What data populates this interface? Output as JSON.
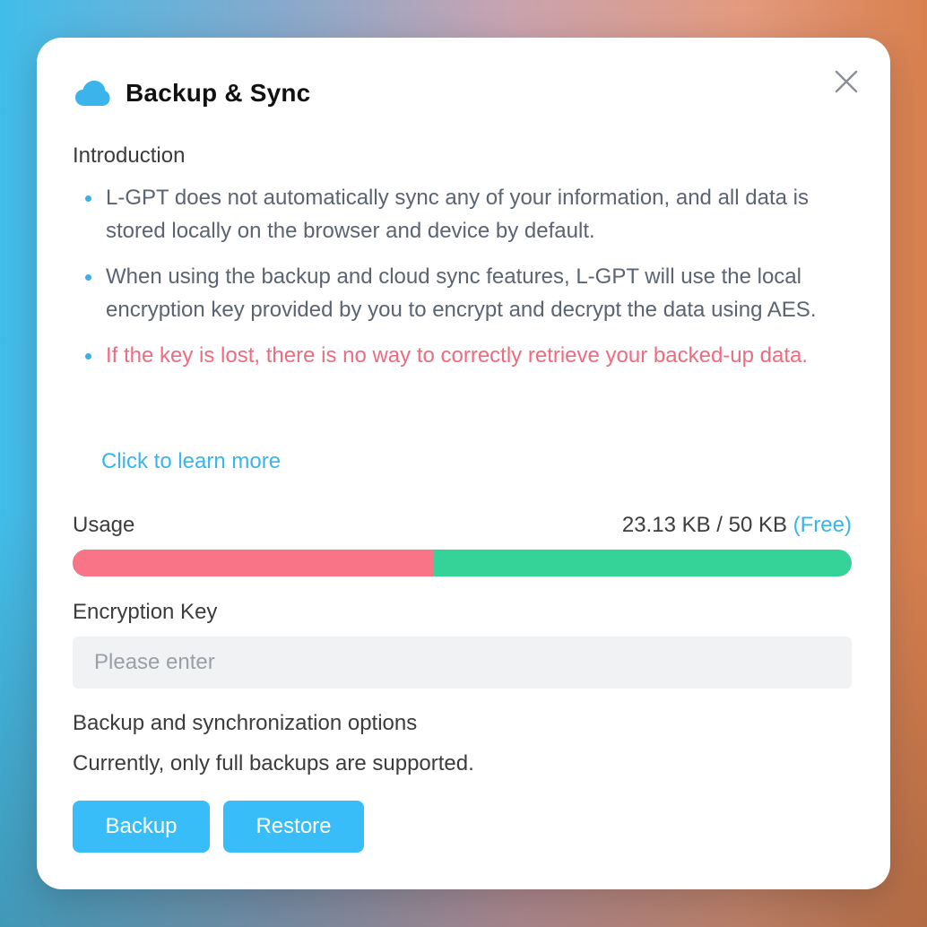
{
  "dialog": {
    "title": "Backup & Sync",
    "close_icon": "close-icon",
    "cloud_icon": "cloud-icon",
    "accent_color": "#38bdf8"
  },
  "intro": {
    "label": "Introduction",
    "bullets": [
      "L-GPT does not automatically sync any of your information, and all data is stored locally on the browser and device by default.",
      "When using the backup and cloud sync features, L-GPT will use the local encryption key provided by you to encrypt and decrypt the data using AES.",
      "If the key is lost, there is no way to correctly retrieve your backed-up data."
    ],
    "learn_more": "Click to learn more"
  },
  "usage": {
    "label": "Usage",
    "value": "23.13 KB / 50 KB",
    "plan": "(Free)",
    "used_fraction": 0.4626,
    "used_color": "#f87486",
    "free_color": "#36d399"
  },
  "encryption": {
    "label": "Encryption Key",
    "placeholder": "Please enter",
    "value": ""
  },
  "options": {
    "label": "Backup and synchronization options",
    "description": "Currently, only full backups are supported."
  },
  "buttons": {
    "backup": "Backup",
    "restore": "Restore"
  }
}
